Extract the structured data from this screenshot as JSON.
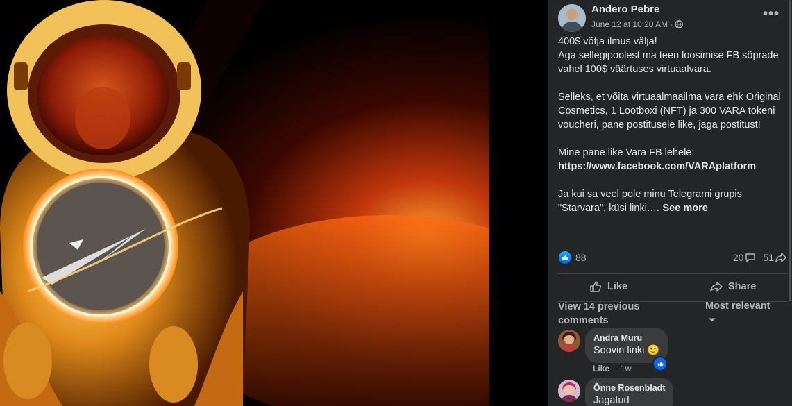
{
  "post": {
    "author": "Andero Pebre",
    "timestamp": "June 12 at 10:20 AM",
    "separator": "·",
    "privacy_icon": "globe-icon",
    "more_icon": "more-options-icon",
    "lines": {
      "l1": "400$ võtja ilmus välja!",
      "l2": "Aga sellegipoolest ma teen loosimise FB sõprade vahel 100$ väärtuses virtuaalvara.",
      "l3": "Selleks, et võita virtuaalmaailma vara ehk Original Cosmetics, 1 Lootboxi (NFT) ja 300 VARA tokeni voucheri, pane postitusele like, jaga postitust!",
      "l4": "Mine pane like Vara FB lehele:",
      "link": "https://www.facebook.com/VARAplatform",
      "l5": "Ja kui sa veel pole minu Telegrami grupis \"Starvara\", küsi linki.…",
      "see_more": "See more"
    }
  },
  "stats": {
    "likes": "88",
    "comments": "20",
    "shares": "51"
  },
  "actions": {
    "like": "Like",
    "share": "Share"
  },
  "comments_section": {
    "view_previous": "View 14 previous comments",
    "sort": "Most relevant"
  },
  "comments": [
    {
      "name": "Andra Muru",
      "text": "Soovin linki",
      "emoji": "🙂",
      "like_label": "Like",
      "age": "1w"
    },
    {
      "name": "Õnne Rosenbladt",
      "text": "Jagatud"
    }
  ],
  "colors": {
    "panel_bg": "#242526",
    "text_primary": "#e4e6eb",
    "text_secondary": "#b0b3b8",
    "like_blue": "#0866ff",
    "bubble_bg": "#3a3b3c"
  }
}
